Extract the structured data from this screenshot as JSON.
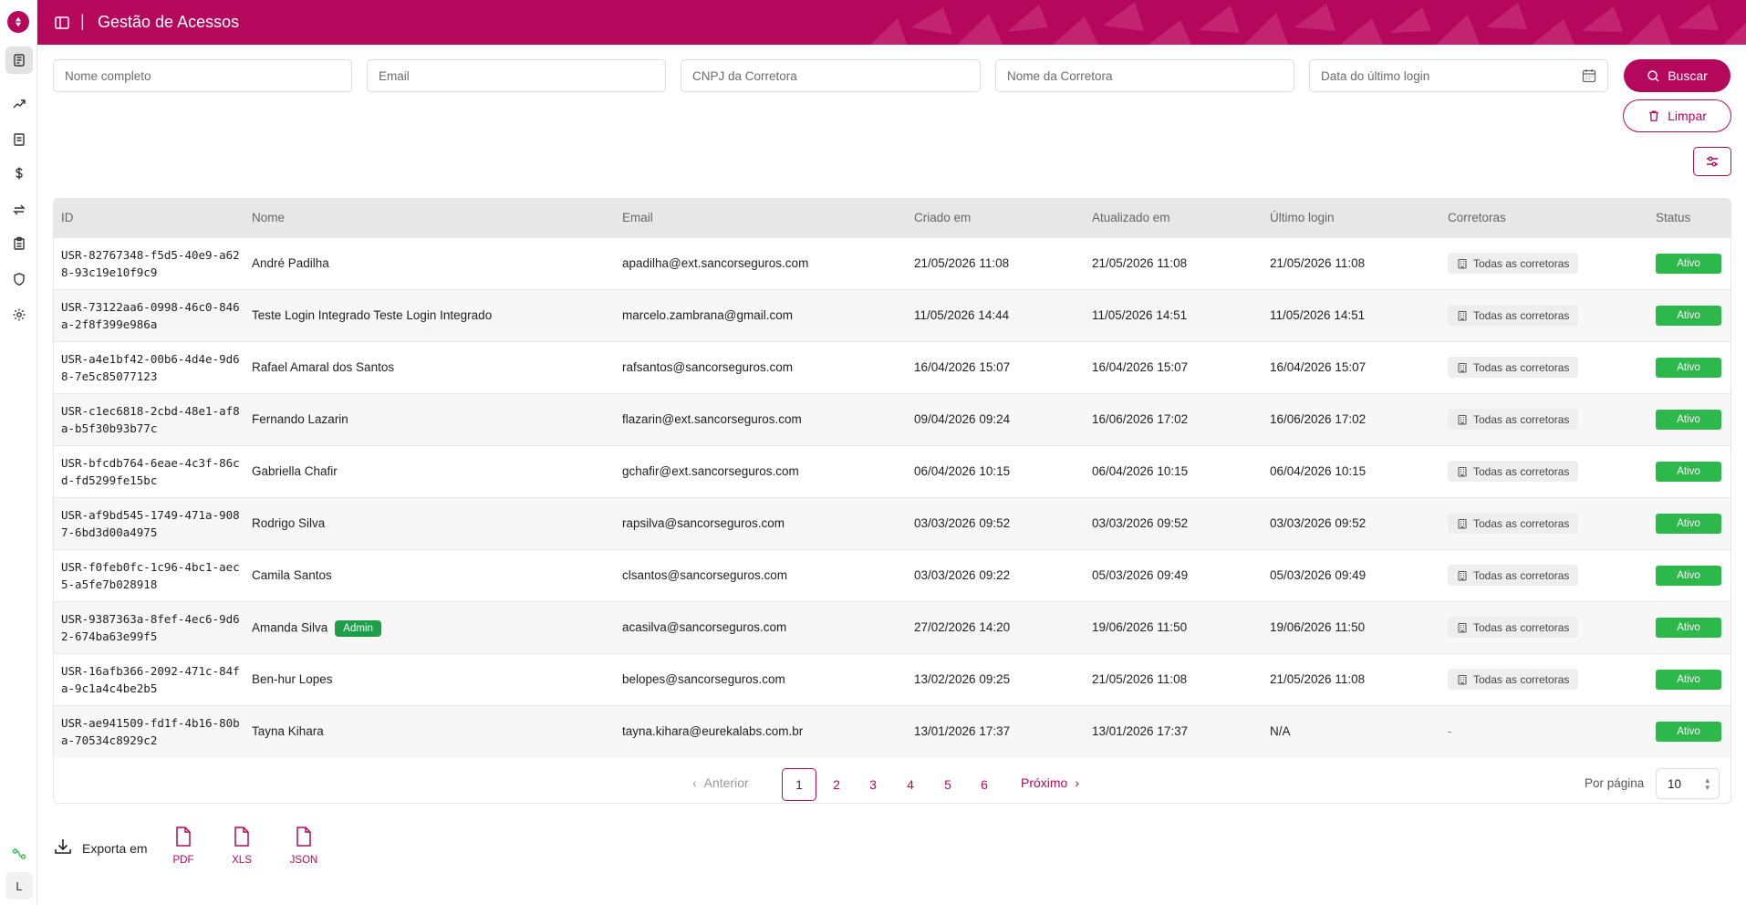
{
  "header": {
    "title": "Gestão de Acessos"
  },
  "rail": {
    "avatar_initial": "L"
  },
  "filters": {
    "full_name_placeholder": "Nome completo",
    "email_placeholder": "Email",
    "cnpj_placeholder": "CNPJ da Corretora",
    "broker_name_placeholder": "Nome da Corretora",
    "last_login_placeholder": "Data do último login",
    "search_label": "Buscar",
    "clear_label": "Limpar"
  },
  "table": {
    "columns": [
      "ID",
      "Nome",
      "Email",
      "Criado em",
      "Atualizado em",
      "Último login",
      "Corretoras",
      "Status"
    ],
    "rows": [
      {
        "id": "USR-82767348-f5d5-40e9-a628-93c19e10f9c9",
        "name": "André Padilha",
        "admin": "",
        "email": "apadilha@ext.sancorseguros.com",
        "created": "21/05/2026 11:08",
        "updated": "21/05/2026 11:08",
        "last_login": "21/05/2026 11:08",
        "brokers": "Todas as corretoras",
        "status": "Ativo"
      },
      {
        "id": "USR-73122aa6-0998-46c0-846a-2f8f399e986a",
        "name": "Teste Login Integrado Teste Login Integrado",
        "admin": "",
        "email": "marcelo.zambrana@gmail.com",
        "created": "11/05/2026 14:44",
        "updated": "11/05/2026 14:51",
        "last_login": "11/05/2026 14:51",
        "brokers": "Todas as corretoras",
        "status": "Ativo"
      },
      {
        "id": "USR-a4e1bf42-00b6-4d4e-9d68-7e5c85077123",
        "name": "Rafael Amaral dos Santos",
        "admin": "",
        "email": "rafsantos@sancorseguros.com",
        "created": "16/04/2026 15:07",
        "updated": "16/04/2026 15:07",
        "last_login": "16/04/2026 15:07",
        "brokers": "Todas as corretoras",
        "status": "Ativo"
      },
      {
        "id": "USR-c1ec6818-2cbd-48e1-af8a-b5f30b93b77c",
        "name": "Fernando Lazarin",
        "admin": "",
        "email": "flazarin@ext.sancorseguros.com",
        "created": "09/04/2026 09:24",
        "updated": "16/06/2026 17:02",
        "last_login": "16/06/2026 17:02",
        "brokers": "Todas as corretoras",
        "status": "Ativo"
      },
      {
        "id": "USR-bfcdb764-6eae-4c3f-86cd-fd5299fe15bc",
        "name": "Gabriella Chafir",
        "admin": "",
        "email": "gchafir@ext.sancorseguros.com",
        "created": "06/04/2026 10:15",
        "updated": "06/04/2026 10:15",
        "last_login": "06/04/2026 10:15",
        "brokers": "Todas as corretoras",
        "status": "Ativo"
      },
      {
        "id": "USR-af9bd545-1749-471a-9087-6bd3d00a4975",
        "name": "Rodrigo Silva",
        "admin": "",
        "email": "rapsilva@sancorseguros.com",
        "created": "03/03/2026 09:52",
        "updated": "03/03/2026 09:52",
        "last_login": "03/03/2026 09:52",
        "brokers": "Todas as corretoras",
        "status": "Ativo"
      },
      {
        "id": "USR-f0feb0fc-1c96-4bc1-aec5-a5fe7b028918",
        "name": "Camila Santos",
        "admin": "",
        "email": "clsantos@sancorseguros.com",
        "created": "03/03/2026 09:22",
        "updated": "05/03/2026 09:49",
        "last_login": "05/03/2026 09:49",
        "brokers": "Todas as corretoras",
        "status": "Ativo"
      },
      {
        "id": "USR-9387363a-8fef-4ec6-9d62-674ba63e99f5",
        "name": "Amanda Silva",
        "admin": "Admin",
        "email": "acasilva@sancorseguros.com",
        "created": "27/02/2026 14:20",
        "updated": "19/06/2026 11:50",
        "last_login": "19/06/2026 11:50",
        "brokers": "Todas as corretoras",
        "status": "Ativo"
      },
      {
        "id": "USR-16afb366-2092-471c-84fa-9c1a4c4be2b5",
        "name": "Ben-hur Lopes",
        "admin": "",
        "email": "belopes@sancorseguros.com",
        "created": "13/02/2026 09:25",
        "updated": "21/05/2026 11:08",
        "last_login": "21/05/2026 11:08",
        "brokers": "Todas as corretoras",
        "status": "Ativo"
      },
      {
        "id": "USR-ae941509-fd1f-4b16-80ba-70534c8929c2",
        "name": "Tayna Kihara",
        "admin": "",
        "email": "tayna.kihara@eurekalabs.com.br",
        "created": "13/01/2026 17:37",
        "updated": "13/01/2026 17:37",
        "last_login": "N/A",
        "brokers": "-",
        "status": "Ativo"
      }
    ]
  },
  "pagination": {
    "prev_label": "Anterior",
    "next_label": "Próximo",
    "pages": [
      "1",
      "2",
      "3",
      "4",
      "5",
      "6"
    ],
    "current": "1",
    "per_page_label": "Por página",
    "per_page_value": "10"
  },
  "export": {
    "label": "Exporta em",
    "formats": [
      "PDF",
      "XLS",
      "JSON"
    ]
  },
  "colors": {
    "brand": "#b5085d",
    "status_active": "#2db84c",
    "admin_badge": "#1e9e4a"
  },
  "icons": [
    "sidebar-toggle-icon",
    "dashboard-icon",
    "trend-icon",
    "document-icon",
    "dollar-icon",
    "transfer-icon",
    "clipboard-icon",
    "shield-icon",
    "gear-icon",
    "calendar-icon",
    "search-icon",
    "trash-icon",
    "sliders-icon",
    "building-icon",
    "download-icon",
    "file-icon",
    "chevron-left-icon",
    "chevron-right-icon",
    "route-icon"
  ]
}
